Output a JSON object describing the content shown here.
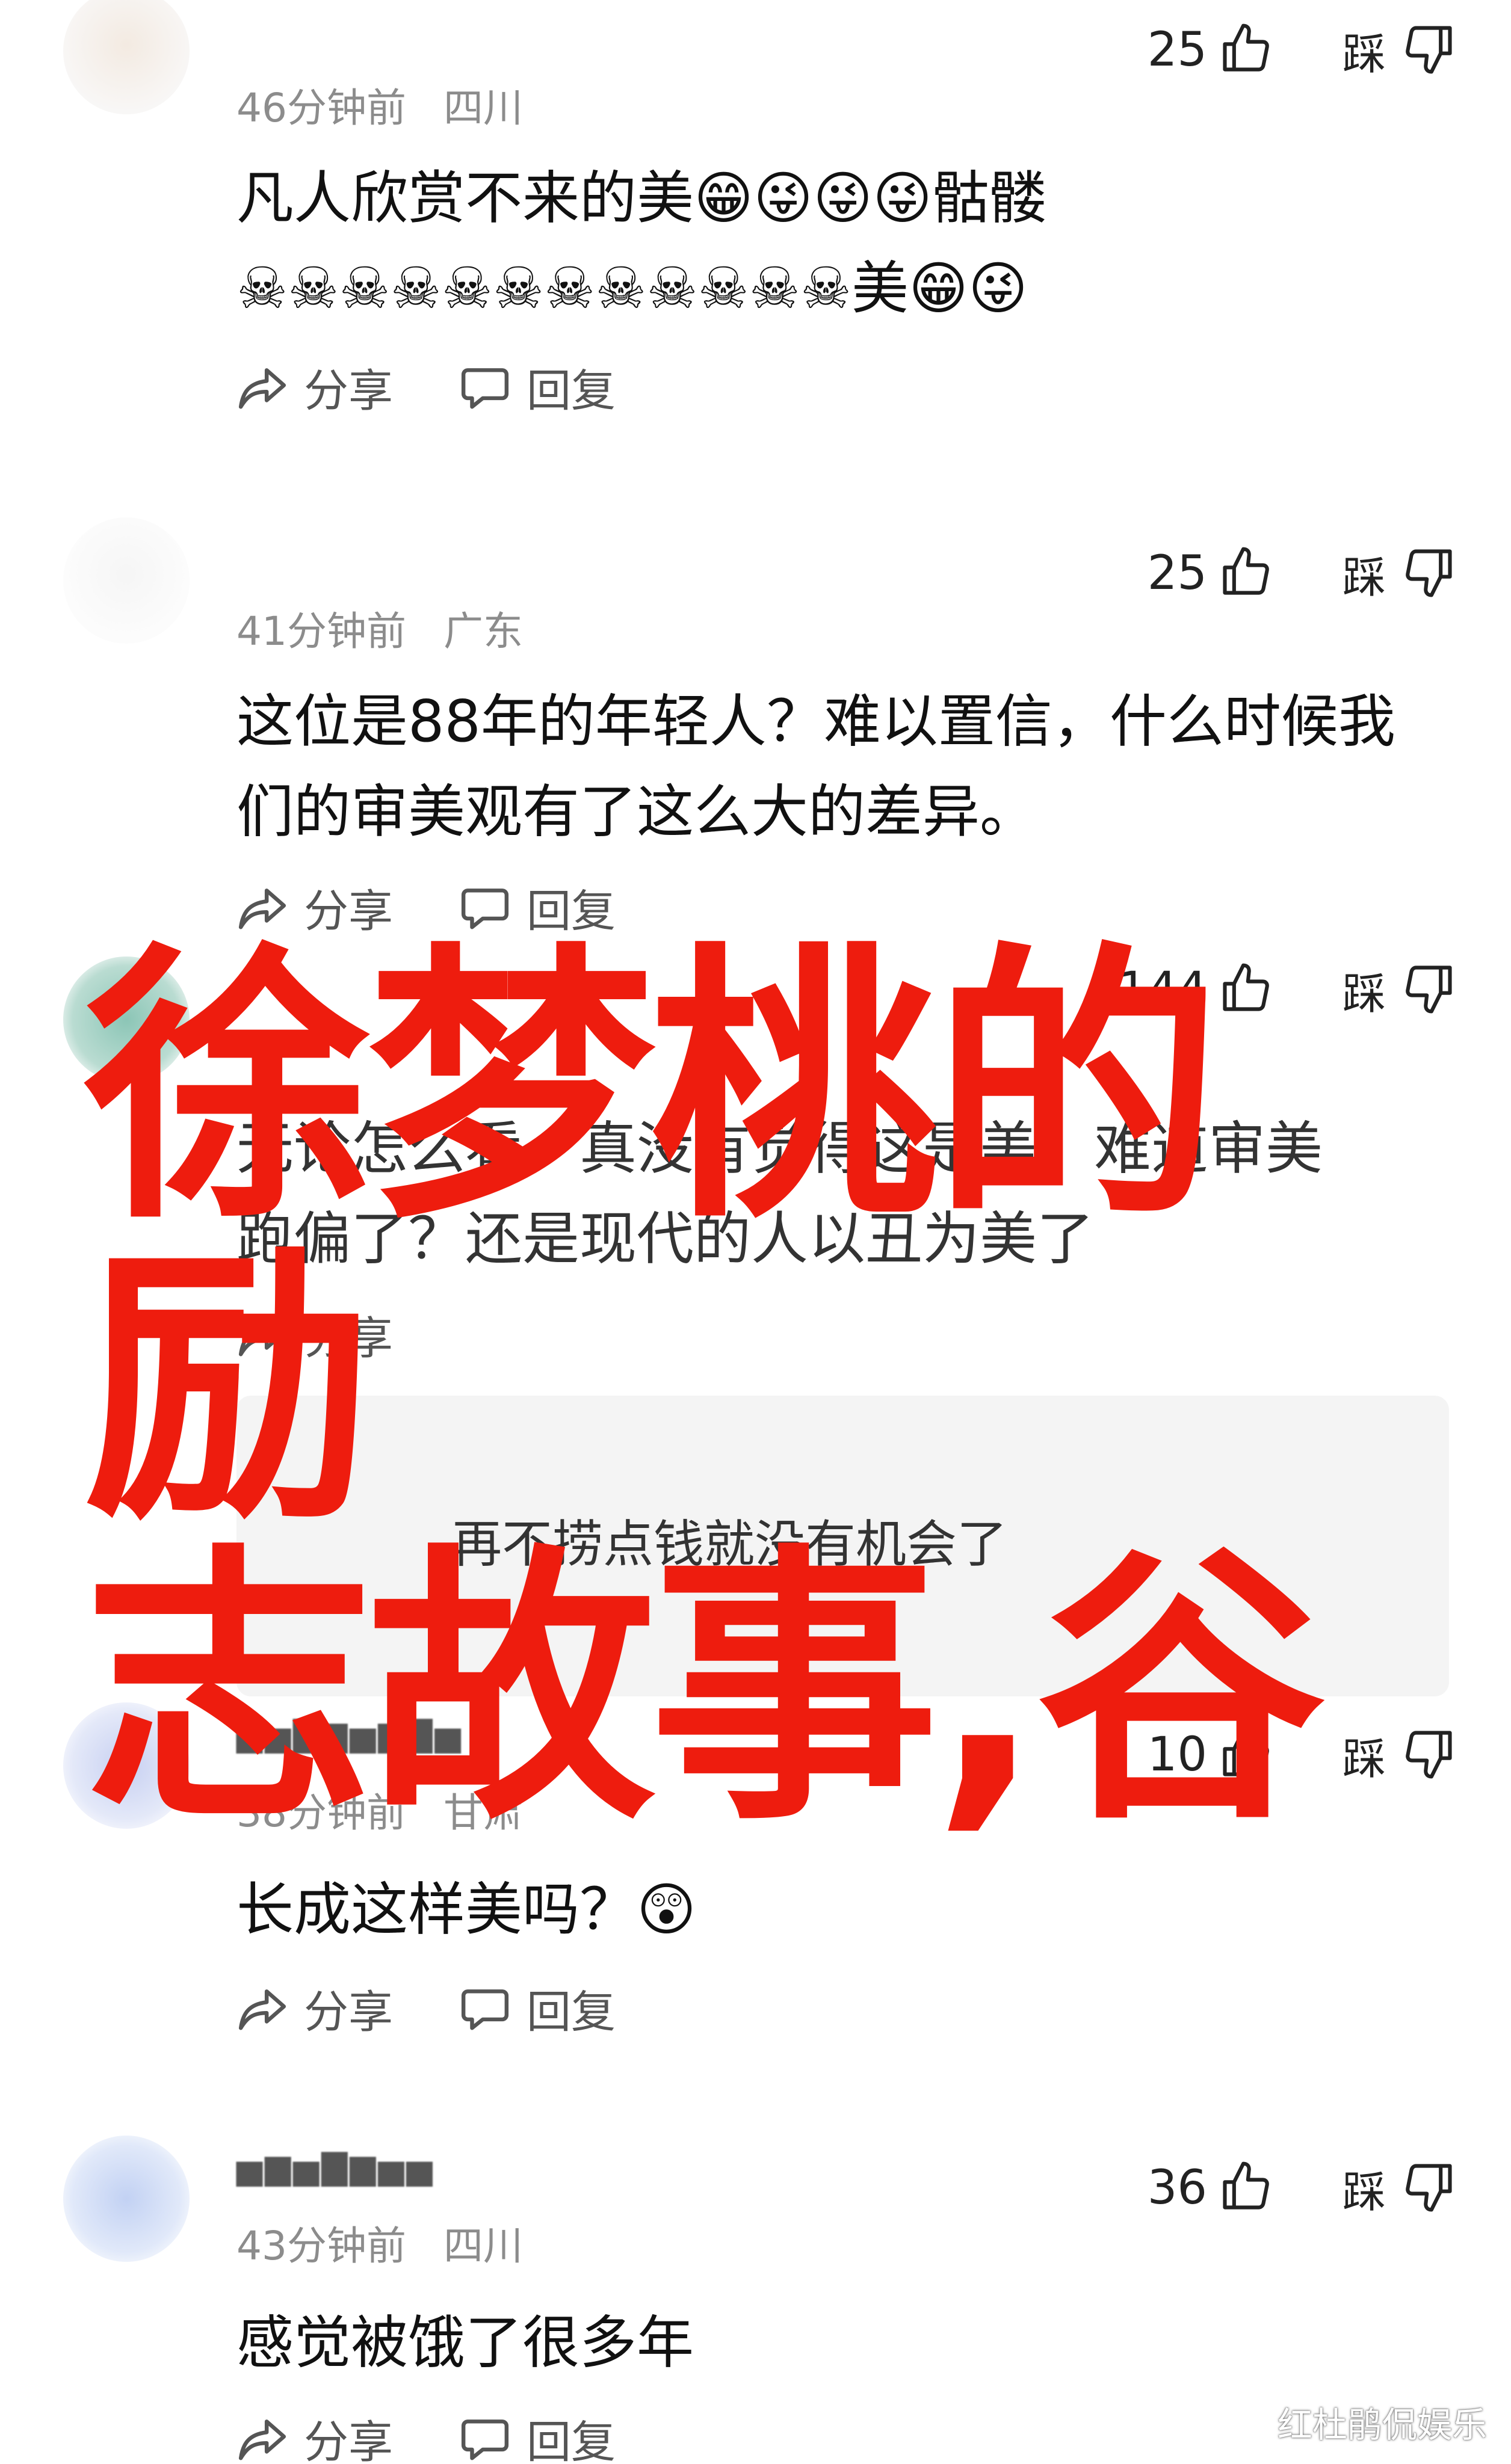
{
  "comments": [
    {
      "time": "46分钟前",
      "region": "四川",
      "likes": "25",
      "dislike_label": "踩",
      "text_line1": "凡人欣赏不来的美😁😜😜😜骷髅",
      "text_line2": "☠☠☠☠☠☠☠☠☠☠☠☠美😁😜",
      "share_label": "分享",
      "reply_label": "回复"
    },
    {
      "time": "41分钟前",
      "region": "广东",
      "likes": "25",
      "dislike_label": "踩",
      "text_line1": "这位是88年的年轻人？难以置信，什么时候我",
      "text_line2": "们的审美观有了这么大的差异。",
      "share_label": "分享",
      "reply_label": "回复"
    },
    {
      "likes": "144",
      "dislike_label": "踩",
      "text_line1": "无论怎么看，真没有觉得这是美，难道审美",
      "text_line2": "跑偏了？还是现代的人以丑为美了",
      "share_label": "分享",
      "quote_text": "再不捞点钱就没有机会了"
    },
    {
      "time": "38分钟前",
      "region": "甘肃",
      "likes": "10",
      "dislike_label": "踩",
      "text_line1": "长成这样美吗？😲",
      "share_label": "分享",
      "reply_label": "回复"
    },
    {
      "time": "43分钟前",
      "region": "四川",
      "likes": "36",
      "dislike_label": "踩",
      "text_line1": "感觉被饿了很多年",
      "share_label": "分享",
      "reply_label": "回复"
    }
  ],
  "overlay_title_line1": "徐梦桃的励",
  "overlay_title_line2": "志故事,谷",
  "watermark": "红杜鹃侃娱乐",
  "colors": {
    "overlay_red": "#ee1c0e",
    "meta_gray": "#8c8c8c"
  },
  "icons": [
    "thumbs-up-icon",
    "thumbs-down-icon",
    "share-icon",
    "reply-icon"
  ]
}
